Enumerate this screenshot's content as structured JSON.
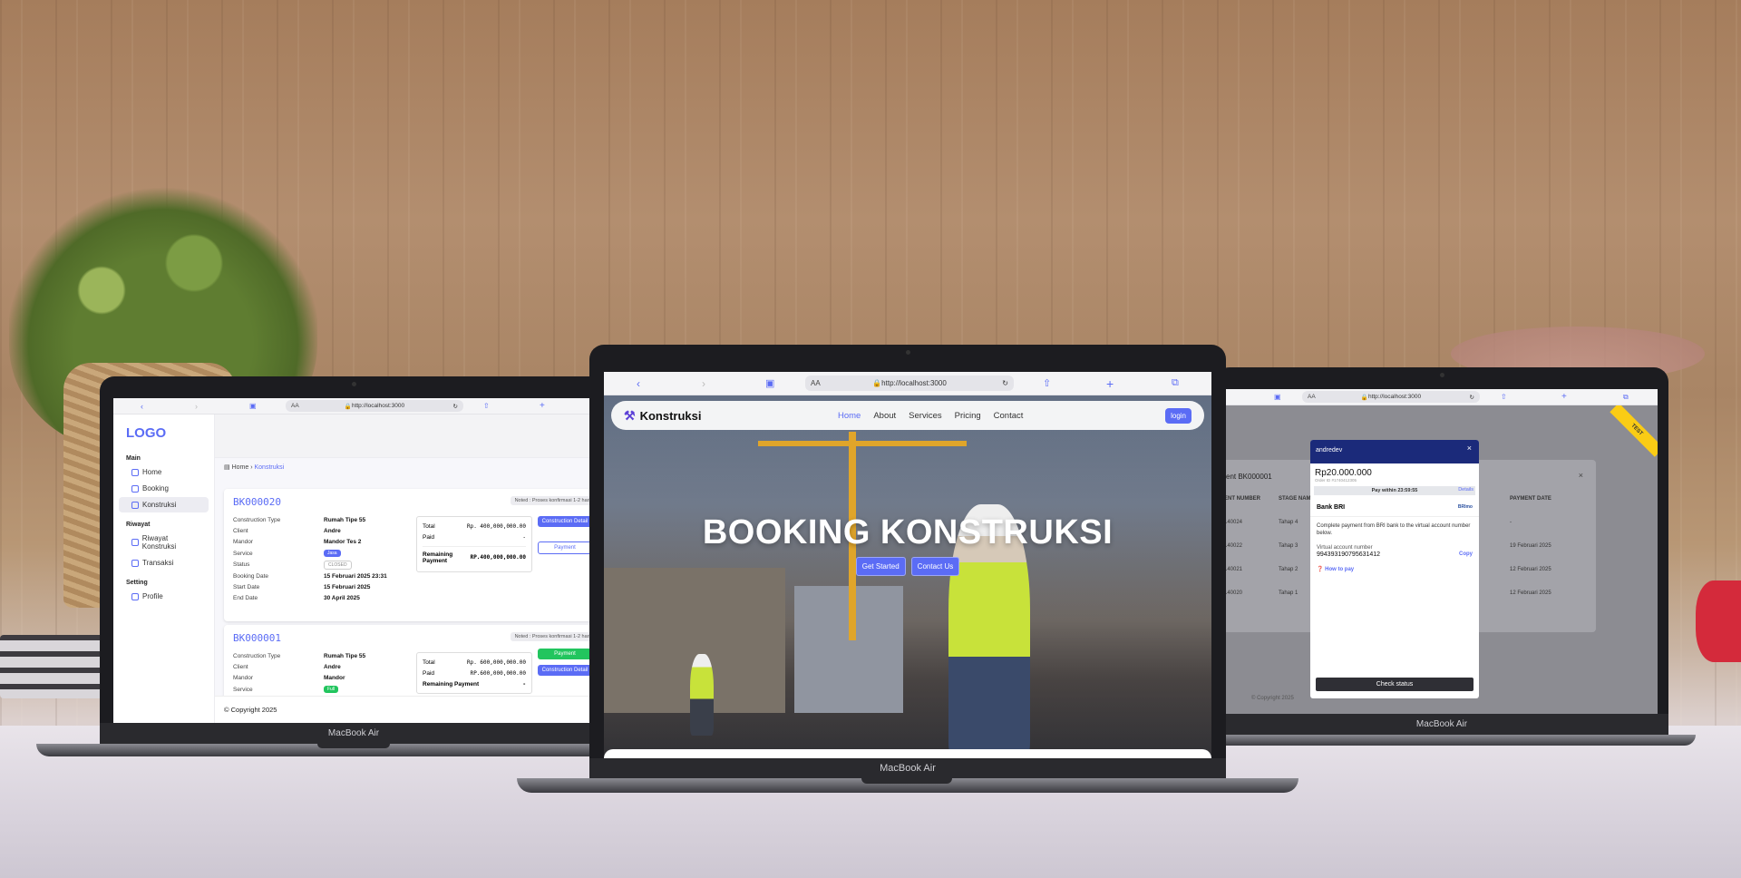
{
  "scene": {
    "laptop_label": "MacBook Air"
  },
  "browser": {
    "url": "http://localhost:3000",
    "text_size": "AA"
  },
  "left_app": {
    "logo": "LOGO",
    "groups": [
      {
        "label": "Main",
        "items": [
          "Home",
          "Booking",
          "Konstruksi"
        ]
      },
      {
        "label": "Riwayat",
        "items": [
          "Riwayat Konstruksi",
          "Transaksi"
        ]
      },
      {
        "label": "Setting",
        "items": [
          "Profile"
        ]
      }
    ],
    "breadcrumb": {
      "home": "Home",
      "current": "Konstruksi"
    },
    "bookings": [
      {
        "id": "BK000020",
        "note": "Noted : Proses konfirmasi 1-2 hari setelah",
        "fields": [
          {
            "k": "Construction Type",
            "v": "Rumah Tipe 55"
          },
          {
            "k": "Client",
            "v": "Andre"
          },
          {
            "k": "Mandor",
            "v": "Mandor Tes 2"
          },
          {
            "k": "Service",
            "v": "Jasa"
          },
          {
            "k": "Status",
            "v": "CLOSED"
          },
          {
            "k": "Booking Date",
            "v": "15 Februari 2025 23:31"
          },
          {
            "k": "Start Date",
            "v": "15 Februari 2025"
          },
          {
            "k": "End Date",
            "v": "30 April 2025"
          }
        ],
        "summary": {
          "total_label": "Total",
          "total": "Rp. 400,000,000.00",
          "paid_label": "Paid",
          "paid": "-",
          "remaining_label": "Remaining Payment",
          "remaining": "RP.400,000,000.00"
        },
        "buttons": [
          "Construction Detail",
          "Payment"
        ]
      },
      {
        "id": "BK000001",
        "note": "Noted : Proses konfirmasi 1-2 hari setelah",
        "fields": [
          {
            "k": "Construction Type",
            "v": "Rumah Tipe 55"
          },
          {
            "k": "Client",
            "v": "Andre"
          },
          {
            "k": "Mandor",
            "v": "Mandor"
          },
          {
            "k": "Service",
            "v": "Full"
          }
        ],
        "summary": {
          "total_label": "Total",
          "total": "Rp. 600,000,000.00",
          "paid_label": "Paid",
          "paid": "RP.600,000,000.00",
          "remaining_label": "Remaining Payment",
          "remaining": "-"
        },
        "buttons": [
          "Payment",
          "Construction Detail"
        ]
      }
    ],
    "copyright": "© Copyright 2025"
  },
  "center_app": {
    "brand": "Konstruksi",
    "menu": [
      "Home",
      "About",
      "Services",
      "Pricing",
      "Contact"
    ],
    "login": "login",
    "hero_title": "BOOKING KONSTRUKSI",
    "buttons": [
      "Get Started",
      "Contact Us"
    ]
  },
  "right_app": {
    "table_title": "ent BK000001",
    "headers": [
      "ENT NUMBER",
      "STAGE NAM",
      "PAYMENT DATE"
    ],
    "rows": [
      {
        "num": "140024",
        "stage": "Tahap 4",
        "date": "-"
      },
      {
        "num": "140022",
        "stage": "Tahap 3",
        "date": "19 Februari 2025"
      },
      {
        "num": "140021",
        "stage": "Tahap 2",
        "date": "12 Februari 2025"
      },
      {
        "num": "140020",
        "stage": "Tahap 1",
        "date": "12 Februari 2025"
      }
    ],
    "ribbon": "TEST",
    "copyright": "© Copyright 2025",
    "modal": {
      "user": "andredev",
      "amount": "Rp20.000.000",
      "order_id": "Order ID #1740412305",
      "details": "Details",
      "pay_within": "Pay within 23:59:55",
      "bank": "Bank BRI",
      "bank_logo": "BRImo",
      "instruction": "Complete payment from BRI bank to the virtual account number below.",
      "va_label": "Virtual account number",
      "va_number": "994393190795631412",
      "copy": "Copy",
      "how_to_pay": "How to pay",
      "check_status": "Check status"
    }
  }
}
